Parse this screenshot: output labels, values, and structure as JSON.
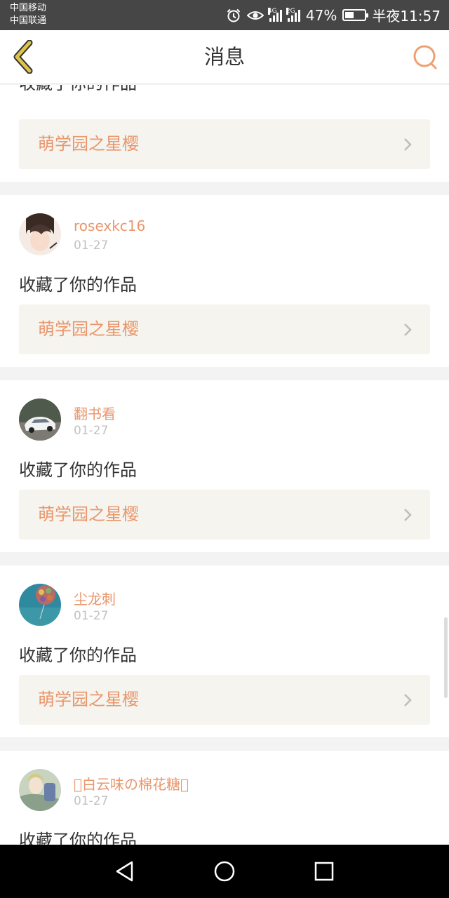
{
  "status_bar": {
    "carrier1": "中国移动",
    "carrier2": "中国联通",
    "net1": "4G",
    "net2": "2G",
    "battery_percent": "47%",
    "battery_level": 0.47,
    "time": "半夜11:57",
    "icons": [
      "alarm-icon",
      "eye-icon",
      "signal-icon",
      "battery-icon"
    ]
  },
  "header": {
    "title": "消息",
    "back_icon": "chevron-left-icon",
    "search_icon": "search-icon"
  },
  "messages": [
    {
      "action": "收藏了你的作品",
      "work": "萌学园之星樱"
    },
    {
      "user": "rosexkc16",
      "date": "01-27",
      "action": "收藏了你的作品",
      "work": "萌学园之星樱"
    },
    {
      "user": "翻书看",
      "date": "01-27",
      "action": "收藏了你的作品",
      "work": "萌学园之星樱"
    },
    {
      "user": "尘龙刺",
      "date": "01-27",
      "action": "收藏了你的作品",
      "work": "萌学园之星樱"
    },
    {
      "user": "\u0000白云味の棉花糖\u0000",
      "date": "01-27",
      "action": "收藏了你的作品"
    }
  ],
  "nav_icons": [
    "back-triangle-icon",
    "home-circle-icon",
    "recents-square-icon"
  ],
  "colors": {
    "accent": "#e9966c",
    "back_icon": "#c8a838",
    "status_bar": "#464646",
    "work_bg": "#f5f4ee"
  }
}
